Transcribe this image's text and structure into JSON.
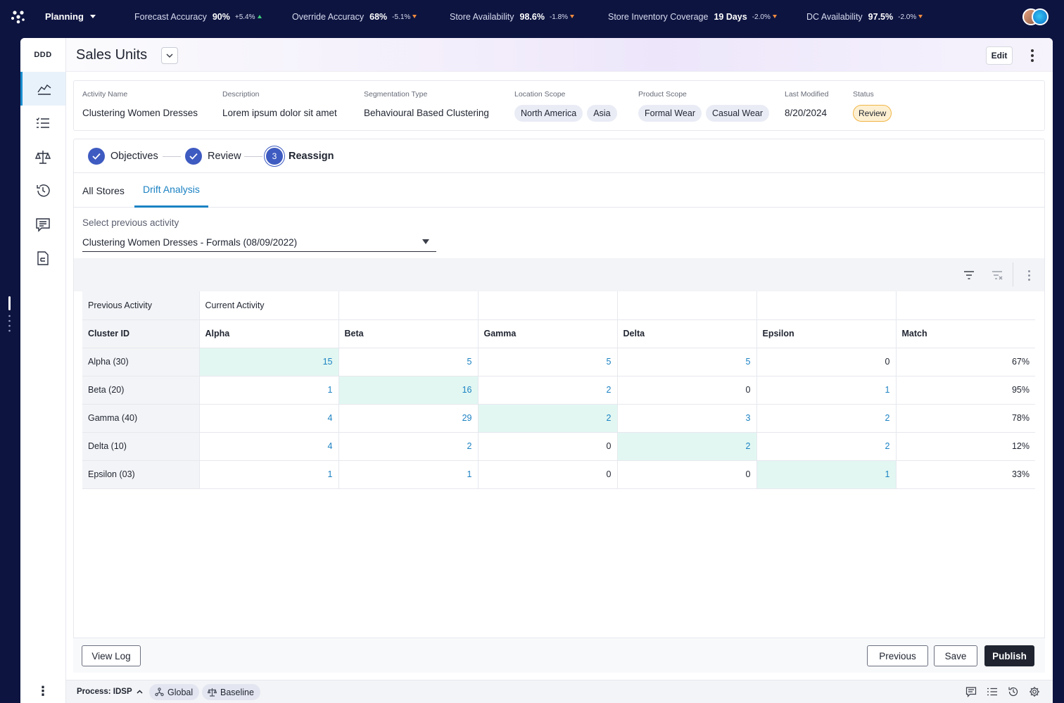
{
  "topbar": {
    "app_menu": "Planning",
    "kpis": [
      {
        "label": "Forecast Accuracy",
        "value": "90%",
        "change": "+5.4%",
        "direction": "up"
      },
      {
        "label": "Override Accuracy",
        "value": "68%",
        "change": "-5.1%",
        "direction": "down"
      },
      {
        "label": "Store Availability",
        "value": "98.6%",
        "change": "-1.8%",
        "direction": "down"
      },
      {
        "label": "Store Inventory Coverage",
        "value": "19 Days",
        "change": "-2.0%",
        "direction": "down"
      },
      {
        "label": "DC Availability",
        "value": "97.5%",
        "change": "-2.0%",
        "direction": "down"
      }
    ]
  },
  "sidenav": {
    "brand": "DDD",
    "items": [
      {
        "icon": "chart-line-icon",
        "active": true
      },
      {
        "icon": "checklist-icon",
        "active": false
      },
      {
        "icon": "scale-icon",
        "active": false
      },
      {
        "icon": "history-icon",
        "active": false
      },
      {
        "icon": "comment-icon",
        "active": false
      },
      {
        "icon": "document-icon",
        "active": false
      }
    ]
  },
  "header": {
    "title": "Sales Units",
    "edit_label": "Edit"
  },
  "info": {
    "activity_name": {
      "label": "Activity Name",
      "value": "Clustering Women Dresses"
    },
    "description": {
      "label": "Description",
      "value": "Lorem ipsum dolor sit amet"
    },
    "segmentation_type": {
      "label": "Segmentation Type",
      "value": "Behavioural Based Clustering"
    },
    "location_scope": {
      "label": "Location Scope",
      "chips": [
        "North America",
        "Asia"
      ]
    },
    "product_scope": {
      "label": "Product Scope",
      "chips": [
        "Formal Wear",
        "Casual Wear"
      ]
    },
    "last_modified": {
      "label": "Last Modified",
      "value": "8/20/2024"
    },
    "status": {
      "label": "Status",
      "value": "Review"
    }
  },
  "stepper": {
    "steps": [
      {
        "label": "Objectives",
        "state": "done"
      },
      {
        "label": "Review",
        "state": "done"
      },
      {
        "label": "Reassign",
        "state": "current",
        "number": "3"
      }
    ]
  },
  "tabs": [
    {
      "label": "All Stores",
      "active": false
    },
    {
      "label": "Drift Analysis",
      "active": true
    }
  ],
  "select": {
    "label": "Select previous activity",
    "value": "Clustering Women Dresses - Formals (08/09/2022)"
  },
  "table": {
    "group_header": {
      "left": "Previous Activity",
      "right": "Current Activity"
    },
    "columns": [
      "Cluster ID",
      "Alpha",
      "Beta",
      "Gamma",
      "Delta",
      "Epsilon",
      "Match"
    ],
    "rows": [
      {
        "id": "Alpha (30)",
        "cells": [
          "15",
          "5",
          "5",
          "5",
          "0"
        ],
        "match": "67%"
      },
      {
        "id": "Beta (20)",
        "cells": [
          "1",
          "16",
          "2",
          "0",
          "1"
        ],
        "match": "95%"
      },
      {
        "id": "Gamma (40)",
        "cells": [
          "4",
          "29",
          "2",
          "3",
          "2"
        ],
        "match": "78%"
      },
      {
        "id": "Delta (10)",
        "cells": [
          "4",
          "2",
          "0",
          "2",
          "2"
        ],
        "match": "12%"
      },
      {
        "id": "Epsilon (03)",
        "cells": [
          "1",
          "1",
          "0",
          "0",
          "1"
        ],
        "match": "33%"
      }
    ]
  },
  "footer": {
    "view_log": "View Log",
    "previous": "Previous",
    "save": "Save",
    "publish": "Publish"
  },
  "statusbar": {
    "process": "Process: IDSP",
    "chips": [
      "Global",
      "Baseline"
    ]
  },
  "colors": {
    "background": "#0d1440",
    "accent": "#1b82c3",
    "step": "#3e5bc1",
    "diagonal": "#e2f7f2",
    "status_badge": "#fdf0d2"
  }
}
